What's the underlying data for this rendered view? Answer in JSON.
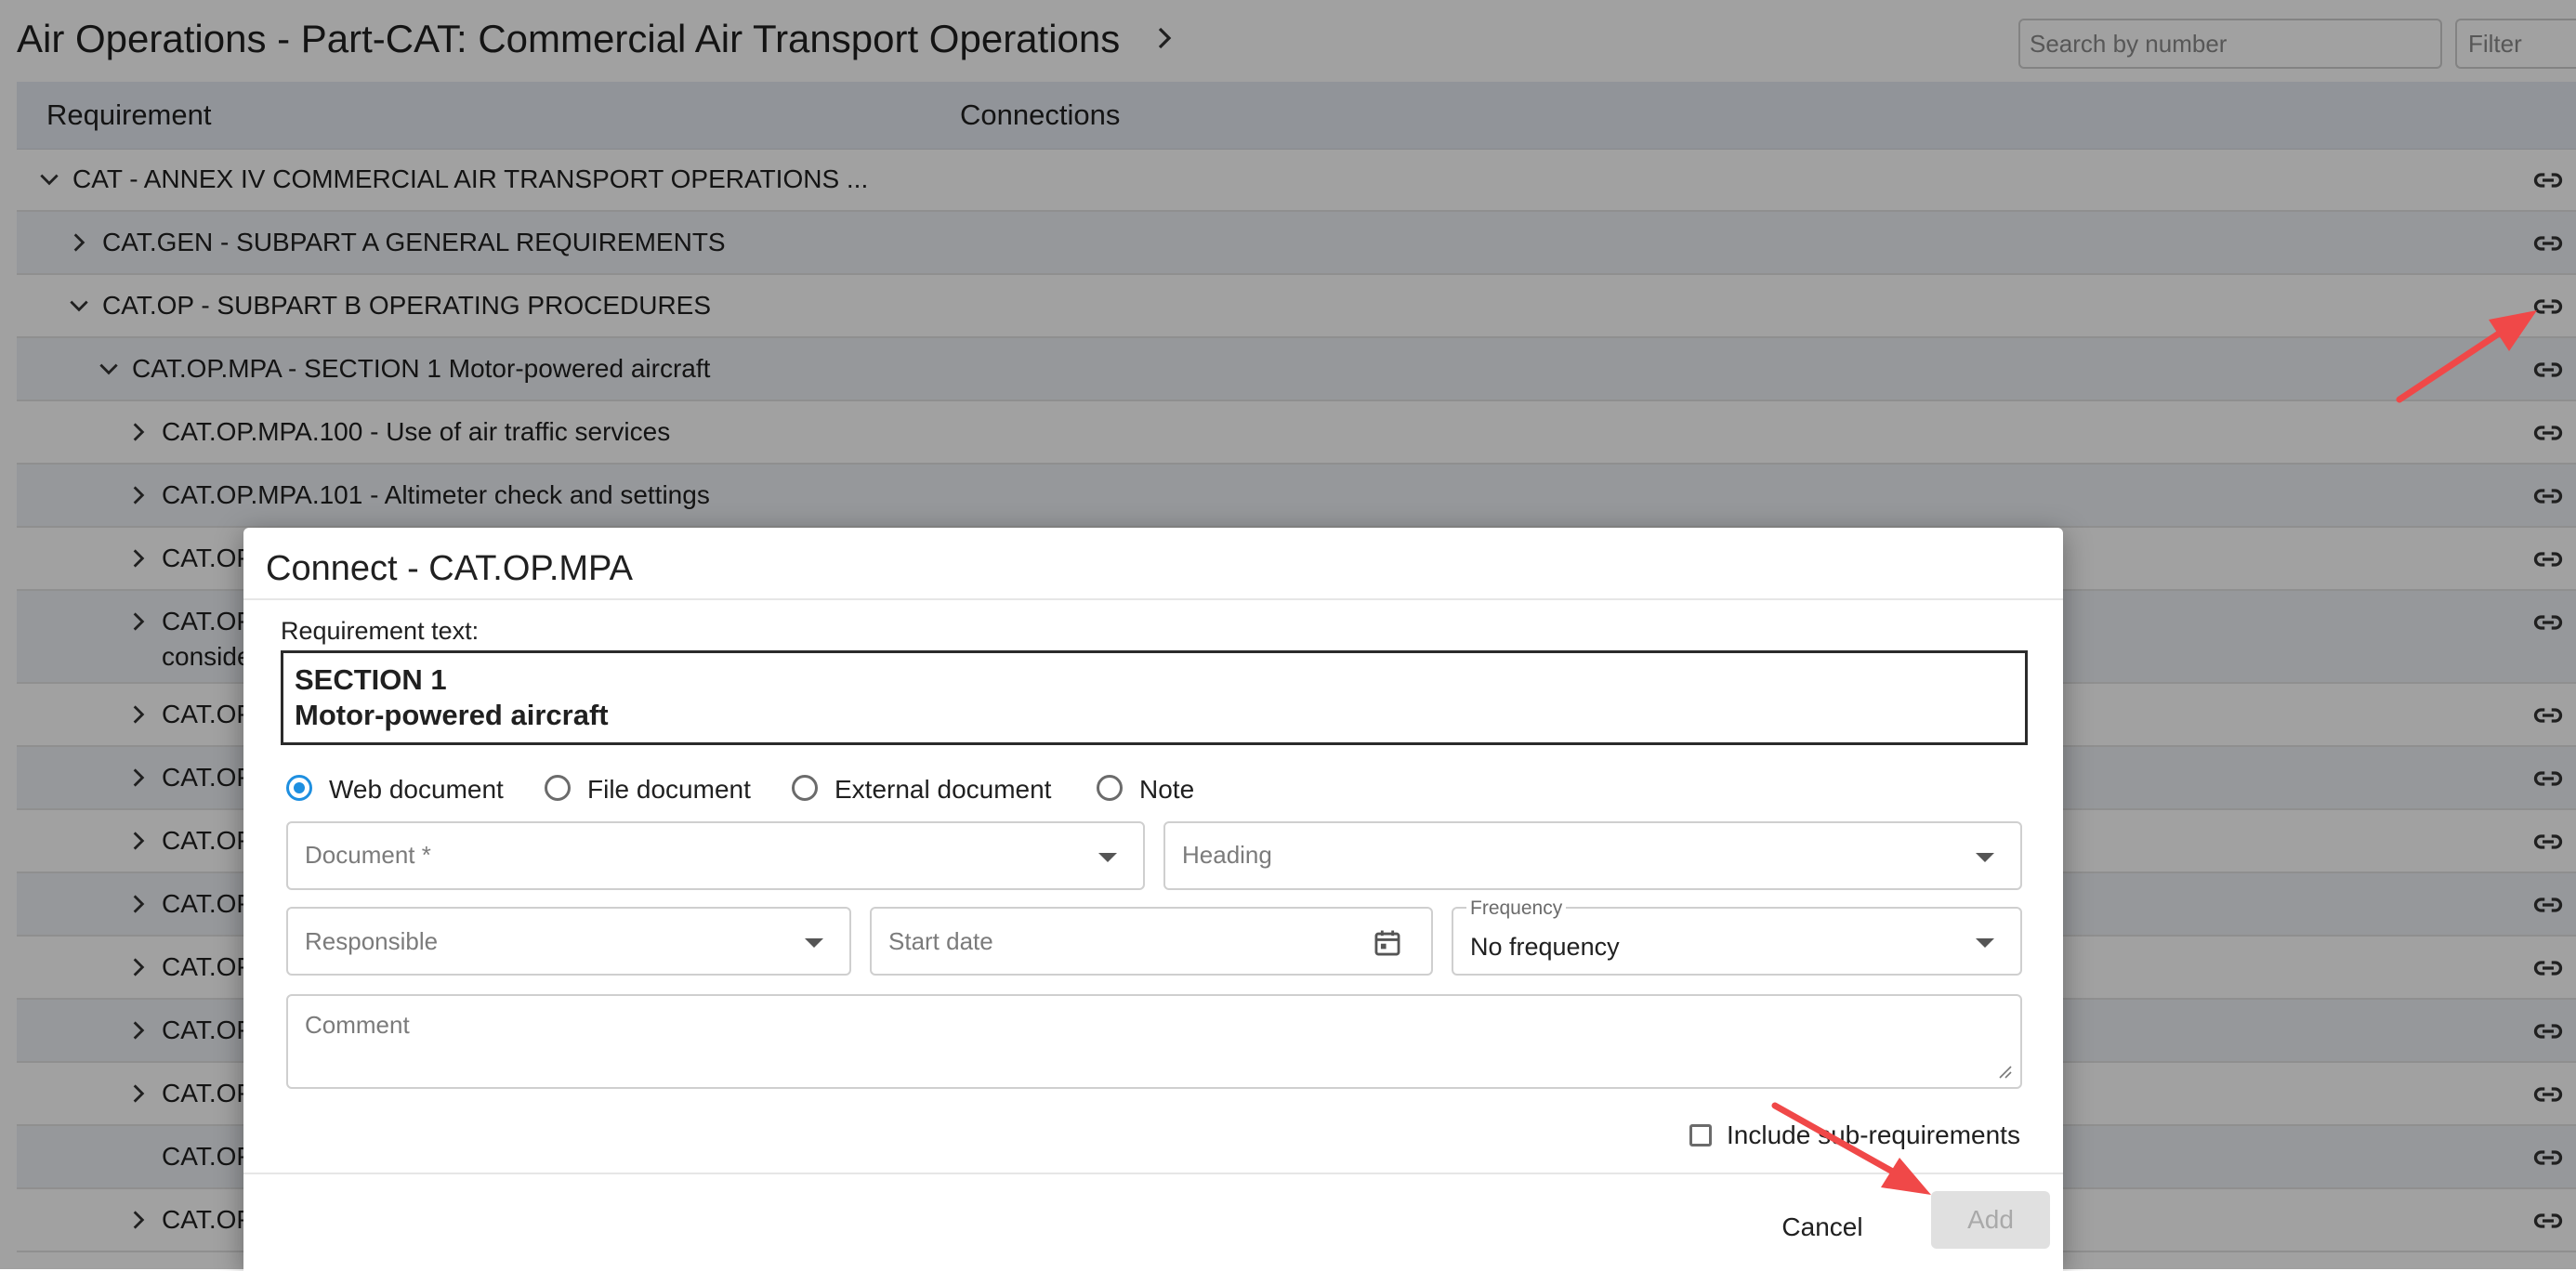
{
  "header": {
    "title": "Air Operations - Part-CAT: Commercial Air Transport Operations",
    "search_placeholder": "Search by number",
    "filter_placeholder": "Filter"
  },
  "table": {
    "columns": [
      "Requirement",
      "Connections"
    ],
    "rows": [
      {
        "label": "CAT - ANNEX IV COMMERCIAL AIR TRANSPORT OPERATIONS ...",
        "expanded": true
      },
      {
        "label": "CAT.GEN - SUBPART A GENERAL REQUIREMENTS",
        "expanded": false
      },
      {
        "label": "CAT.OP - SUBPART B OPERATING PROCEDURES",
        "expanded": true
      },
      {
        "label": "CAT.OP.MPA - SECTION 1 Motor-powered aircraft",
        "expanded": true
      },
      {
        "label": "CAT.OP.MPA.100 - Use of air traffic services",
        "expanded": false
      },
      {
        "label": "CAT.OP.MPA.101 - Altimeter check and settings",
        "expanded": false
      },
      {
        "label": "CAT.OP",
        "expanded": false
      },
      {
        "label": "CAT.OP",
        "label2": "conside",
        "expanded": false
      },
      {
        "label": "CAT.OP",
        "expanded": false
      },
      {
        "label": "CAT.OP",
        "expanded": false
      },
      {
        "label": "CAT.OP",
        "expanded": false
      },
      {
        "label": "CAT.OP",
        "expanded": false
      },
      {
        "label": "CAT.OP",
        "expanded": false
      },
      {
        "label": "CAT.OP",
        "expanded": false
      },
      {
        "label": "CAT.OP",
        "expanded": false
      },
      {
        "label": "CAT.OP",
        "expanded": null
      },
      {
        "label": "CAT.OP",
        "expanded": false
      }
    ]
  },
  "dialog": {
    "title": "Connect - CAT.OP.MPA",
    "requirement_label": "Requirement text:",
    "requirement_text": [
      "SECTION 1",
      "Motor-powered aircraft"
    ],
    "doc_types": [
      {
        "label": "Web document",
        "selected": true
      },
      {
        "label": "File document",
        "selected": false
      },
      {
        "label": "External document",
        "selected": false
      },
      {
        "label": "Note",
        "selected": false
      }
    ],
    "document_placeholder": "Document *",
    "heading_placeholder": "Heading",
    "responsible_placeholder": "Responsible",
    "start_date_placeholder": "Start date",
    "frequency_label": "Frequency",
    "frequency_value": "No frequency",
    "comment_placeholder": "Comment",
    "include_sub_label": "Include sub-requirements",
    "include_sub_checked": false,
    "cancel_label": "Cancel",
    "add_label": "Add",
    "add_enabled": false
  },
  "colors": {
    "accent": "#1e8fe0",
    "annotation_arrow": "#f04848",
    "header_bg": "#e6eaf2"
  }
}
